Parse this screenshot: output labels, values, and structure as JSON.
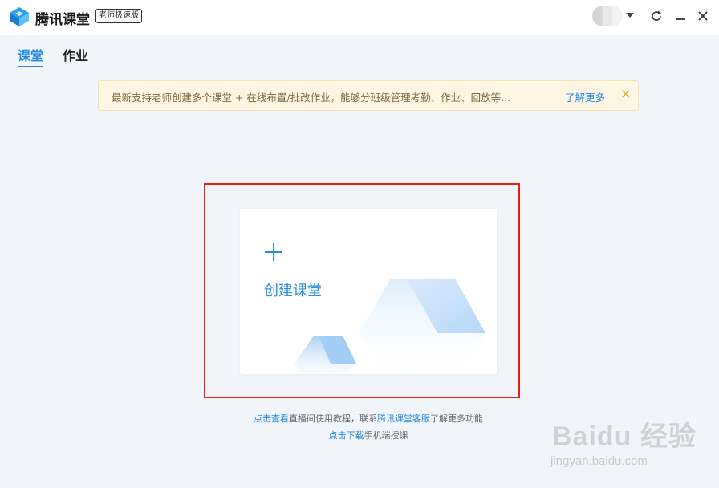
{
  "app": {
    "title": "腾讯课堂",
    "edition_badge": "老师极速版"
  },
  "window_controls": {
    "icons": [
      "refresh-icon",
      "minimize-icon",
      "close-icon"
    ]
  },
  "tabs": [
    {
      "label": "课堂",
      "active": true
    },
    {
      "label": "作业",
      "active": false
    }
  ],
  "notice": {
    "text": "最新支持老师创建多个课堂 + 在线布置/批改作业，能够分班级管理考勤、作业、回放等...",
    "link": "了解更多",
    "close_icon": "×"
  },
  "create_card": {
    "plus_icon": "+",
    "label": "创建课堂"
  },
  "help": {
    "line1": {
      "link1": "点击查看",
      "text1": "直播间使用教程，联系",
      "link2": "腾讯课堂客服",
      "text2": "了解更多功能"
    },
    "line2": {
      "link": "点击下载",
      "text": "手机端授课"
    }
  },
  "watermark": {
    "brand": "Baidu 经验",
    "url": "jingyan.baidu.com"
  },
  "colors": {
    "accent": "#1e88e5",
    "highlight": "#e0201d",
    "notice_bg": "#fdf6e2",
    "page_bg": "#f1f4f8"
  }
}
